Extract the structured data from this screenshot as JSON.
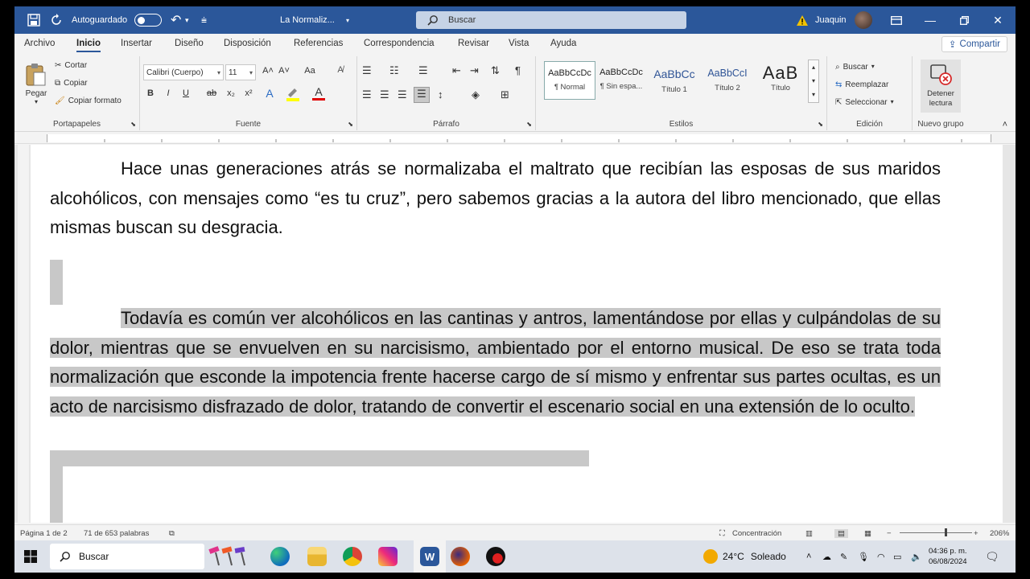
{
  "titlebar": {
    "autosave_label": "Autoguardado",
    "doc_title": "La Normaliz...",
    "search_placeholder": "Buscar",
    "user_name": "Juaquin"
  },
  "menu": {
    "tabs": [
      "Archivo",
      "Inicio",
      "Insertar",
      "Diseño",
      "Disposición",
      "Referencias",
      "Correspondencia",
      "Revisar",
      "Vista",
      "Ayuda"
    ],
    "active_tab": "Inicio",
    "share_label": "Compartir"
  },
  "ribbon": {
    "clipboard": {
      "paste": "Pegar",
      "cut": "Cortar",
      "copy": "Copiar",
      "format_painter": "Copiar formato",
      "label": "Portapapeles"
    },
    "font": {
      "name": "Calibri (Cuerpo)",
      "size": "11",
      "grow": "A˄",
      "shrink": "A˅",
      "case": "Aa",
      "bold": "B",
      "italic": "I",
      "underline": "U",
      "strike": "ab",
      "sub": "x₂",
      "sup": "x²",
      "label": "Fuente"
    },
    "paragraph": {
      "label": "Párrafo",
      "pilcrow": "¶"
    },
    "styles": {
      "items": [
        {
          "preview": "AaBbCcDc",
          "name": "¶ Normal"
        },
        {
          "preview": "AaBbCcDc",
          "name": "¶ Sin espa..."
        },
        {
          "preview": "AaBbCc",
          "name": "Título 1"
        },
        {
          "preview": "AaBbCcI",
          "name": "Título 2"
        },
        {
          "preview": "AaB",
          "name": "Título"
        }
      ],
      "label": "Estilos"
    },
    "editing": {
      "find": "Buscar",
      "replace": "Reemplazar",
      "select": "Seleccionar",
      "label": "Edición"
    },
    "newgroup": {
      "stop_line1": "Detener",
      "stop_line2": "lectura",
      "label": "Nuevo grupo"
    }
  },
  "document": {
    "para1": "Hace unas generaciones atrás se normalizaba el maltrato que recibían las esposas de sus maridos alcohólicos, con mensajes como “es tu cruz”, pero sabemos gracias a la autora del libro mencionado, que ellas mismas buscan su desgracia.",
    "para2": "Todavía es común ver alcohólicos en las cantinas y antros, lamentándose por ellas y culpándolas de su dolor, mientras que se envuelven en su narcisismo, ambientado por el entorno musical. De eso se trata toda normalización que esconde la impotencia frente hacerse cargo de sí mismo y enfrentar sus partes ocultas, es un acto de narcisismo disfrazado de dolor, tratando de convertir el escenario social en una extensión de lo oculto."
  },
  "status": {
    "page": "Página 1 de 2",
    "words": "71 de 653 palabras",
    "focus": "Concentración",
    "zoom": "206%"
  },
  "taskbar": {
    "search_placeholder": "Buscar",
    "weather_temp": "24°C",
    "weather_text": "Soleado",
    "time": "04:36 p. m.",
    "date": "06/08/2024"
  }
}
